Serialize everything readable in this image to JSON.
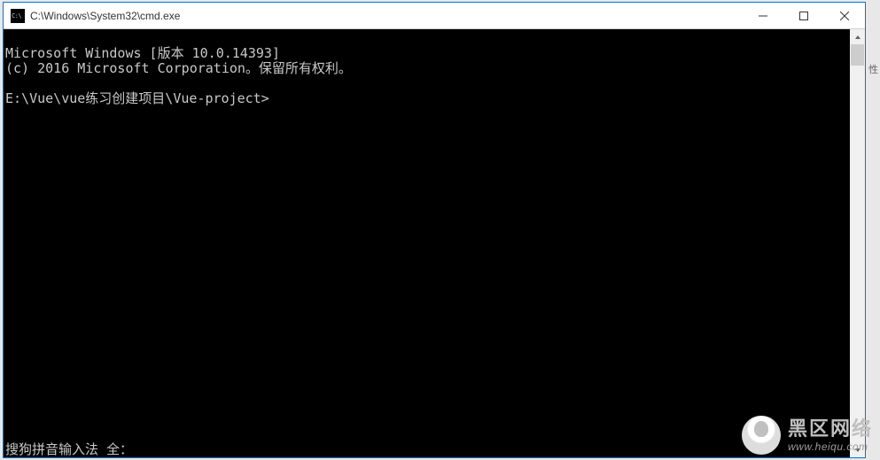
{
  "titlebar": {
    "icon_name": "cmd-icon",
    "title": "C:\\Windows\\System32\\cmd.exe"
  },
  "terminal": {
    "line1": "Microsoft Windows [版本 10.0.14393]",
    "line2": "(c) 2016 Microsoft Corporation。保留所有权利。",
    "blank": "",
    "prompt": "E:\\Vue\\vue练习创建项目\\Vue-project>",
    "ime_status": "搜狗拼音输入法 全："
  },
  "right_strip": {
    "label": "性"
  },
  "watermark": {
    "line1": "黑区网络",
    "line2": "www.heiqu.com"
  }
}
